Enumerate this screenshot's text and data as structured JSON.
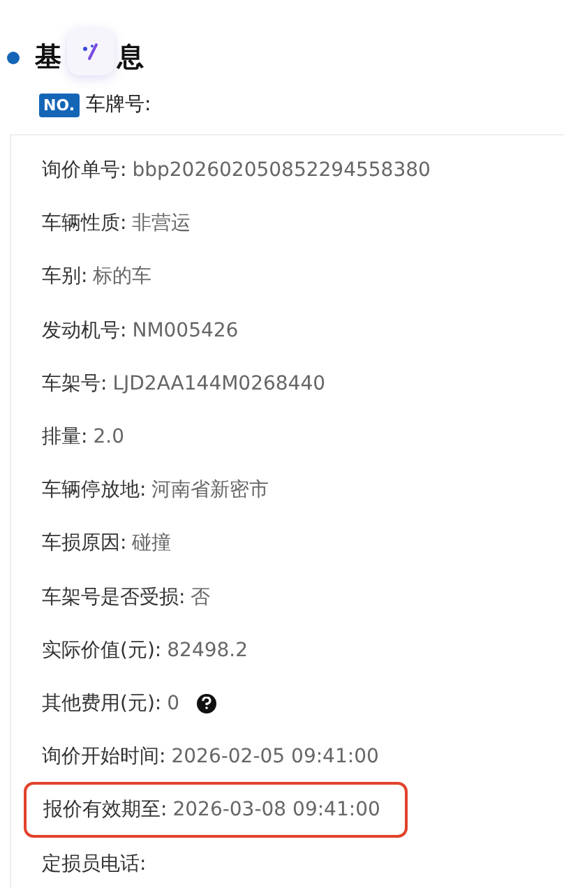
{
  "section": {
    "title_parts": [
      "基",
      "息"
    ],
    "plate": {
      "badge": "NO.",
      "label": "车牌号:"
    }
  },
  "fields": [
    {
      "label": "询价单号:",
      "value": "bbp202602050852294558380",
      "highlighted": false,
      "help": false
    },
    {
      "label": "车辆性质:",
      "value": "非营运",
      "highlighted": false,
      "help": false
    },
    {
      "label": "车别:",
      "value": "标的车",
      "highlighted": false,
      "help": false
    },
    {
      "label": "发动机号:",
      "value": "NM005426",
      "highlighted": false,
      "help": false
    },
    {
      "label": "车架号:",
      "value": "LJD2AA144M0268440",
      "highlighted": false,
      "help": false
    },
    {
      "label": "排量:",
      "value": "2.0",
      "highlighted": false,
      "help": false
    },
    {
      "label": "车辆停放地:",
      "value": "河南省新密市",
      "highlighted": false,
      "help": false
    },
    {
      "label": "车损原因:",
      "value": "碰撞",
      "highlighted": false,
      "help": false
    },
    {
      "label": "车架号是否受损:",
      "value": "否",
      "highlighted": false,
      "help": false
    },
    {
      "label": "实际价值(元):",
      "value": "82498.2",
      "highlighted": false,
      "help": false
    },
    {
      "label": "其他费用(元):",
      "value": "0",
      "highlighted": false,
      "help": true
    },
    {
      "label": "询价开始时间:",
      "value": "2026-02-05 09:41:00",
      "highlighted": false,
      "help": false
    },
    {
      "label": "报价有效期至:",
      "value": "2026-03-08 09:41:00",
      "highlighted": true,
      "help": false
    },
    {
      "label": "定损员电话:",
      "highlighted": false,
      "help": false
    }
  ]
}
